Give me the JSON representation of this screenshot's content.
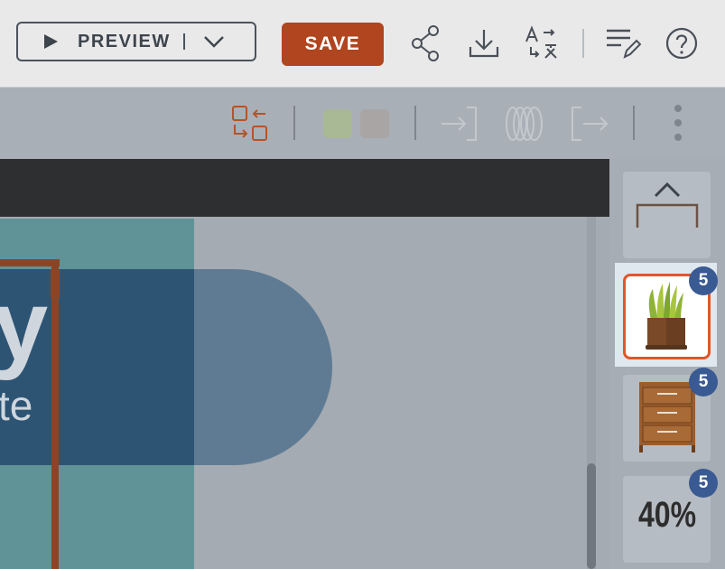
{
  "toolbar": {
    "preview_label": "PREVIEW",
    "save_label": "SAVE",
    "icons": [
      "play-icon",
      "chevron-down-icon",
      "share-icon",
      "download-icon",
      "translate-icon",
      "edit-list-icon",
      "help-icon"
    ]
  },
  "subtoolbar": {
    "icons": [
      "arrange-icon",
      "enter-icon",
      "rings-icon",
      "exit-icon",
      "more-vertical-icon"
    ],
    "swatches": [
      "#a9b996",
      "#a9a5a4"
    ]
  },
  "canvas": {
    "heading_fragment": "y",
    "subheading_fragment": "te"
  },
  "thumbnails": [
    {
      "name": "frame-thumb",
      "badge": ""
    },
    {
      "name": "plant-thumb",
      "badge": "5",
      "selected": true
    },
    {
      "name": "dresser-thumb",
      "badge": "5"
    },
    {
      "name": "percent-thumb",
      "badge": "5",
      "text": "40%"
    }
  ],
  "colors": {
    "accent": "#b0451f",
    "badge": "#3a5a93",
    "selection": "#e0562a"
  }
}
